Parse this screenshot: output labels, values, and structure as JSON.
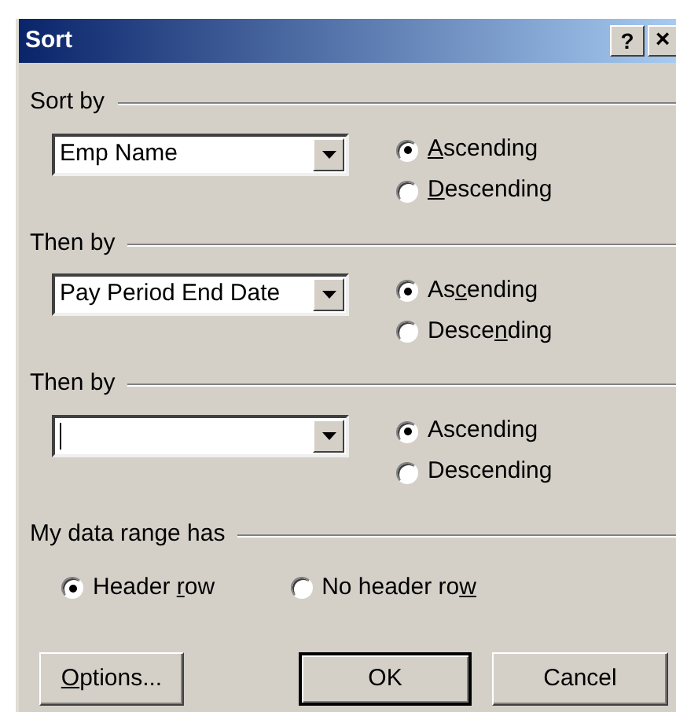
{
  "window": {
    "title": "Sort",
    "help_button": "?",
    "close_button": "×"
  },
  "sections": [
    {
      "label": "Sort by",
      "dropdown": {
        "value": "Emp Name",
        "focused": false
      },
      "options": [
        {
          "label": {
            "key": "A",
            "after": "scending"
          },
          "selected": true
        },
        {
          "label": {
            "key": "D",
            "after": "escending"
          },
          "selected": false
        }
      ]
    },
    {
      "label": "Then by",
      "dropdown": {
        "value": "Pay Period End Date",
        "focused": false
      },
      "options": [
        {
          "label": {
            "before": "As",
            "key": "c",
            "after": "ending"
          },
          "selected": true
        },
        {
          "label": {
            "before": "Desce",
            "key": "n",
            "after": "ding"
          },
          "selected": false
        }
      ]
    },
    {
      "label": "Then by",
      "dropdown": {
        "focused": true
      },
      "options": [
        {
          "label": {
            "before": "Ascendin",
            "key": "g"
          },
          "selected": true
        },
        {
          "label": {
            "before": "Descendin",
            "key": "g"
          },
          "selected": false
        }
      ]
    }
  ],
  "header_group": {
    "label": "My data range has",
    "options": [
      {
        "label": {
          "before": "Header ",
          "key": "r",
          "after": "ow"
        },
        "selected": true
      },
      {
        "label": {
          "before": "No header ro",
          "key": "w"
        },
        "selected": false
      }
    ]
  },
  "buttons": [
    {
      "label": {
        "key": "O",
        "after": "ptions..."
      },
      "default": false
    },
    {
      "label": {
        "before": "OK"
      },
      "default": true
    },
    {
      "label": {
        "before": "Cancel"
      },
      "default": false
    }
  ]
}
